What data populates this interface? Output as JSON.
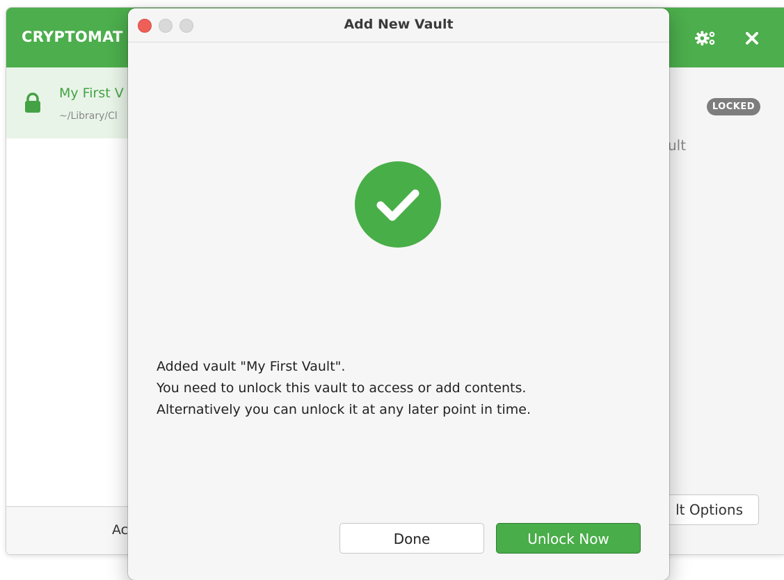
{
  "main_window": {
    "app_title": "CRYPTOMAT",
    "header_icons": {
      "settings": "gears-icon",
      "close": "close-icon"
    },
    "vault": {
      "name": "My First V",
      "path": "~/Library/Cl",
      "status": "LOCKED"
    },
    "detail_subtext": "ult",
    "vault_options_label": "lt Options",
    "add_vault_label": "Ac"
  },
  "dialog": {
    "title": "Add New Vault",
    "message_lines": [
      "Added vault \"My First Vault\".",
      "You need to unlock this vault to access or add contents.",
      "Alternatively you can unlock it at any later point in time."
    ],
    "buttons": {
      "done": "Done",
      "unlock": "Unlock Now"
    }
  },
  "colors": {
    "brand_green": "#4cae4c",
    "button_green": "#49ad49",
    "close_red": "#ee5f57",
    "locked_badge": "#7d7d7d"
  }
}
